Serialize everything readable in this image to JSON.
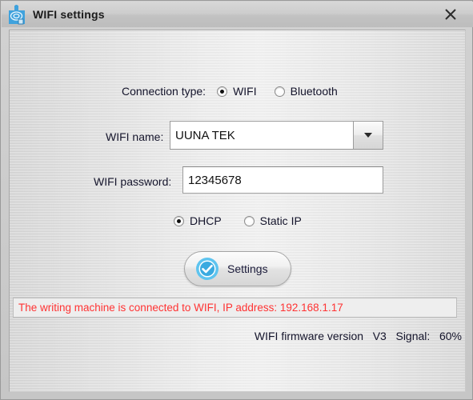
{
  "window": {
    "title": "WIFI settings",
    "icon": "printer-robot-icon",
    "close_icon": "close-icon"
  },
  "form": {
    "connection_type": {
      "label": "Connection type:",
      "options": [
        {
          "label": "WIFI",
          "selected": true
        },
        {
          "label": "Bluetooth",
          "selected": false
        }
      ]
    },
    "wifi_name": {
      "label": "WIFI name:",
      "value": "UUNA TEK",
      "dropdown_icon": "chevron-down-icon"
    },
    "wifi_password": {
      "label": "WIFI password:",
      "value": "12345678"
    },
    "ip_mode": {
      "options": [
        {
          "label": "DHCP",
          "selected": true
        },
        {
          "label": "Static IP",
          "selected": false
        }
      ]
    },
    "settings_button": {
      "label": "Settings",
      "icon": "check-circle-icon"
    }
  },
  "status": {
    "message": "The writing machine is connected to WIFI, IP address: 192.168.1.17",
    "color": "#ff3333"
  },
  "footer": {
    "firmware_label": "WIFI firmware version",
    "firmware_version": "V3",
    "signal_label": "Signal:",
    "signal_value": "60%"
  }
}
